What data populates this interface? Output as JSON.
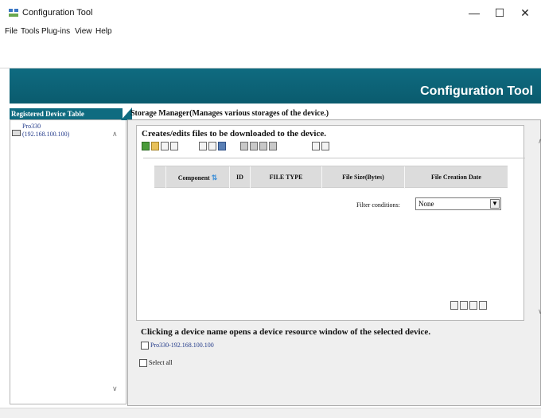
{
  "window": {
    "title": "Configuration Tool",
    "controls": {
      "minimize": "—",
      "maximize": "☐",
      "close": "✕"
    }
  },
  "menu": [
    "File",
    "Tools",
    "Plug-ins",
    "View",
    "Help"
  ],
  "banner": {
    "title": "Configuration Tool",
    "color": "#0f6b80"
  },
  "left_panel": {
    "header": "Registered Device Table",
    "device": {
      "name": "Pro330",
      "ip": "(192.168.100.100)",
      "icon": "device-icon"
    }
  },
  "tab": {
    "label": "Storage Manager(Manages various storages of the device.)"
  },
  "storage": {
    "title": "Creates/edits files to be downloaded to the device.",
    "toolbar_icons": [
      "new-file-icon",
      "open-folder-icon",
      "copy-icon",
      "paste-icon",
      "import-icon",
      "export-icon",
      "grid-icon",
      "download-icon",
      "compare-icon",
      "upload-icon",
      "print-icon",
      "search-icon",
      "settings-icon"
    ],
    "columns": [
      "Component",
      "ID",
      "FILE TYPE",
      "File Size(Bytes)",
      "File Creation Date"
    ],
    "sort_icon": "⇅",
    "filter": {
      "label": "Filter conditions:",
      "value": "None"
    },
    "bottom_icons": [
      "view-icon",
      "grid-view-icon",
      "copy-view-icon",
      "paste-view-icon"
    ]
  },
  "device_section": {
    "title": "Clicking a device name opens a device resource window of the selected device.",
    "device_label": "Pro330-192.168.100.100",
    "select_all": "Select all"
  },
  "scroll": {
    "up": "∧",
    "down": "∨"
  }
}
